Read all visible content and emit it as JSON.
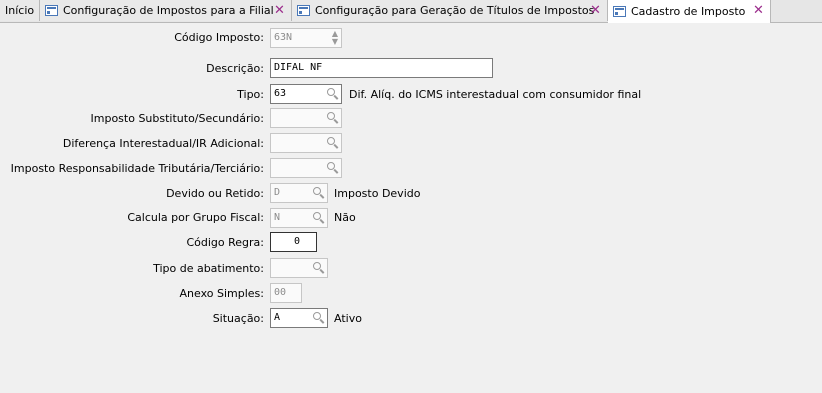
{
  "tabs": [
    {
      "label": "Início"
    },
    {
      "label": "Configuração de Impostos para a Filial"
    },
    {
      "label": "Configuração para Geração de Títulos de Impostos"
    },
    {
      "label": "Cadastro de Imposto"
    }
  ],
  "form": {
    "codigo_imposto": {
      "label": "Código Imposto:",
      "value": "63N"
    },
    "descricao": {
      "label": "Descrição:",
      "value": "DIFAL NF"
    },
    "tipo": {
      "label": "Tipo:",
      "value": "63",
      "desc": "Dif. Alíq. do ICMS interestadual com consumidor final"
    },
    "imposto_substituto": {
      "label": "Imposto Substituto/Secundário:",
      "value": ""
    },
    "diferenca_interestadual": {
      "label": "Diferença Interestadual/IR Adicional:",
      "value": ""
    },
    "imposto_responsabilidade": {
      "label": "Imposto Responsabilidade Tributária/Terciário:",
      "value": ""
    },
    "devido_retido": {
      "label": "Devido ou Retido:",
      "value": "D",
      "desc": "Imposto Devido"
    },
    "calcula_grupo_fiscal": {
      "label": "Calcula por Grupo Fiscal:",
      "value": "N",
      "desc": "Não"
    },
    "codigo_regra": {
      "label": "Código Regra:",
      "value": "0"
    },
    "tipo_abatimento": {
      "label": "Tipo de abatimento:",
      "value": ""
    },
    "anexo_simples": {
      "label": "Anexo Simples:",
      "value": "00"
    },
    "situacao": {
      "label": "Situação:",
      "value": "A",
      "desc": "Ativo"
    }
  },
  "colors": {
    "close_icon": "#9b2d8c",
    "tab_icon": "#4a78b8",
    "background": "#f0f0f0"
  }
}
